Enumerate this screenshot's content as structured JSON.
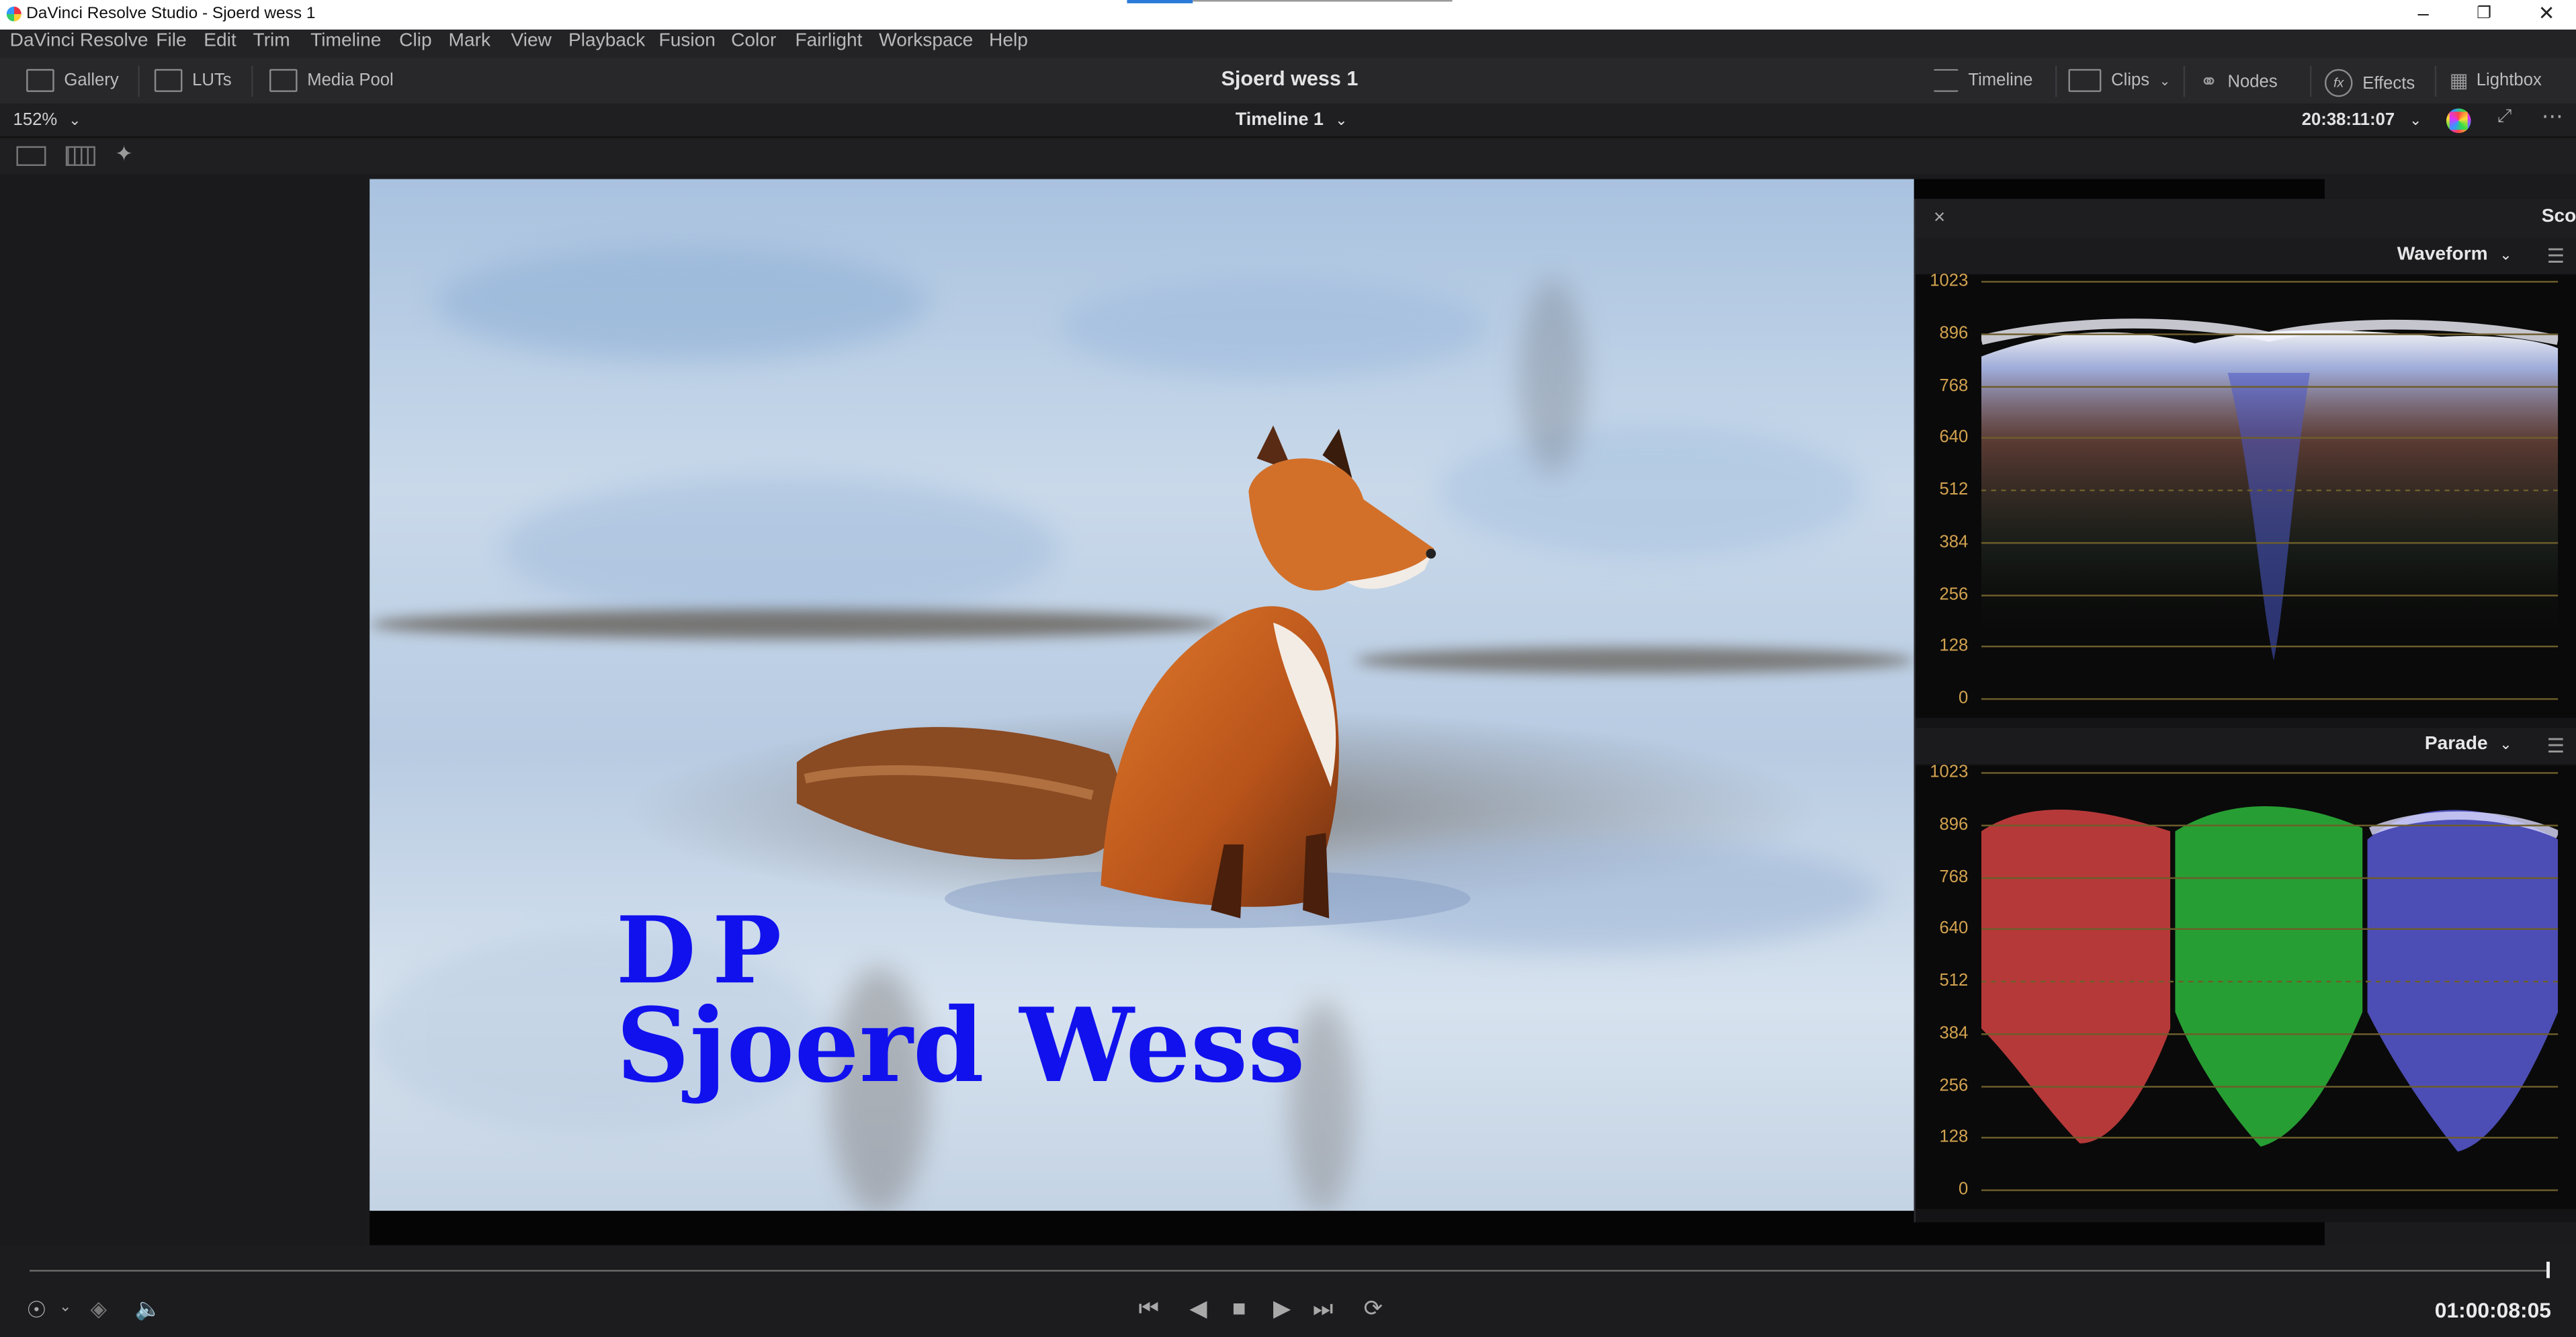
{
  "window": {
    "title": "DaVinci Resolve Studio - Sjoerd wess 1",
    "controls": [
      "minimize",
      "restore",
      "close"
    ]
  },
  "menu": [
    "DaVinci Resolve",
    "File",
    "Edit",
    "Trim",
    "Timeline",
    "Clip",
    "Mark",
    "View",
    "Playback",
    "Fusion",
    "Color",
    "Fairlight",
    "Workspace",
    "Help"
  ],
  "toolbar": {
    "left": [
      {
        "label": "Gallery",
        "icon": "gallery-icon"
      },
      {
        "label": "LUTs",
        "icon": "luts-icon"
      },
      {
        "label": "Media Pool",
        "icon": "media-pool-icon"
      }
    ],
    "project_title": "Sjoerd wess 1",
    "right": [
      {
        "label": "Timeline",
        "icon": "timeline-icon"
      },
      {
        "label": "Clips",
        "icon": "clips-icon"
      },
      {
        "label": "Nodes",
        "icon": "nodes-icon"
      },
      {
        "label": "Effects",
        "icon": "effects-icon"
      },
      {
        "label": "Lightbox",
        "icon": "lightbox-icon"
      }
    ]
  },
  "viewer": {
    "zoom": "152%",
    "timeline_name": "Timeline 1",
    "source_timecode": "20:38:11:07",
    "overlay_line1": "DP",
    "overlay_line2": "Sjoerd Wess"
  },
  "scopes": {
    "panel_title": "Scop",
    "top": {
      "title": "Waveform",
      "ticks": [
        "1023",
        "896",
        "768",
        "640",
        "512",
        "384",
        "256",
        "128",
        "0"
      ]
    },
    "bottom": {
      "title": "Parade",
      "ticks": [
        "1023",
        "896",
        "768",
        "640",
        "512",
        "384",
        "256",
        "128",
        "0"
      ]
    },
    "colors": {
      "red": "#ff4d4d",
      "green": "#33dd44",
      "blue": "#6a6aff",
      "grid": "#6d5e2b",
      "tick": "#d2a24f"
    }
  },
  "transport": {
    "timecode": "01:00:08:05",
    "controls": [
      "skip-to-start",
      "step-back",
      "stop",
      "play",
      "skip-to-end",
      "loop"
    ]
  }
}
